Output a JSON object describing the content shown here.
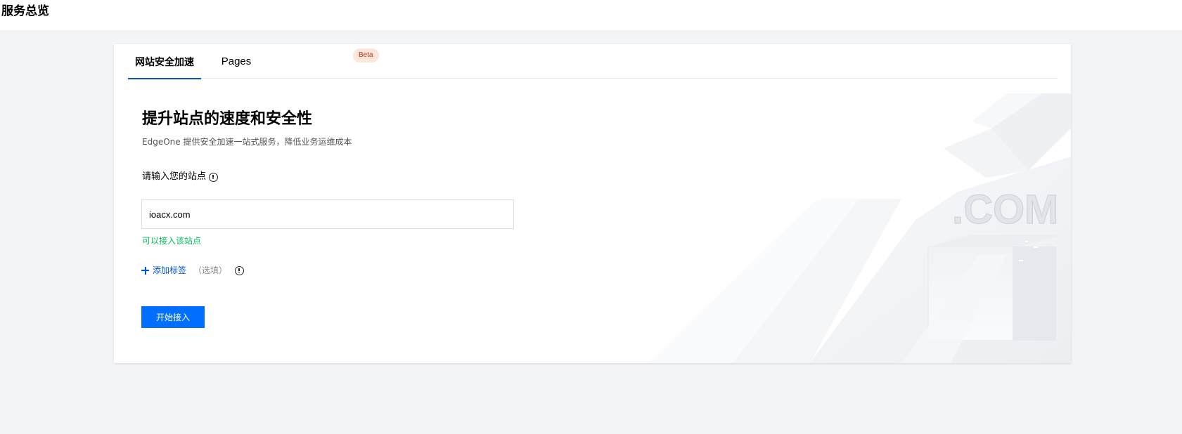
{
  "header": {
    "title": "服务总览"
  },
  "tabs": [
    {
      "label": "网站安全加速",
      "active": true
    },
    {
      "label": "Pages",
      "badge": "Beta"
    }
  ],
  "hero": {
    "title": "提升站点的速度和安全性",
    "subtitle": "EdgeOne 提供安全加速一站式服务，降低业务运维成本"
  },
  "form": {
    "site_label": "请输入您的站点",
    "site_value": "ioacx.com",
    "site_valid_msg": "可以接入该站点",
    "add_tag_label": "添加标签",
    "optional_label": "（选填）",
    "submit_label": "开始接入"
  },
  "illustration": {
    "text": ".COM"
  },
  "colors": {
    "primary": "#006eff",
    "tab_underline": "#0052d9",
    "success": "#0abf5b",
    "badge_bg": "#fde7dc",
    "badge_text": "#b5360c",
    "page_bg": "#f3f4f7"
  },
  "icons": [
    "info-icon",
    "plus-icon"
  ]
}
